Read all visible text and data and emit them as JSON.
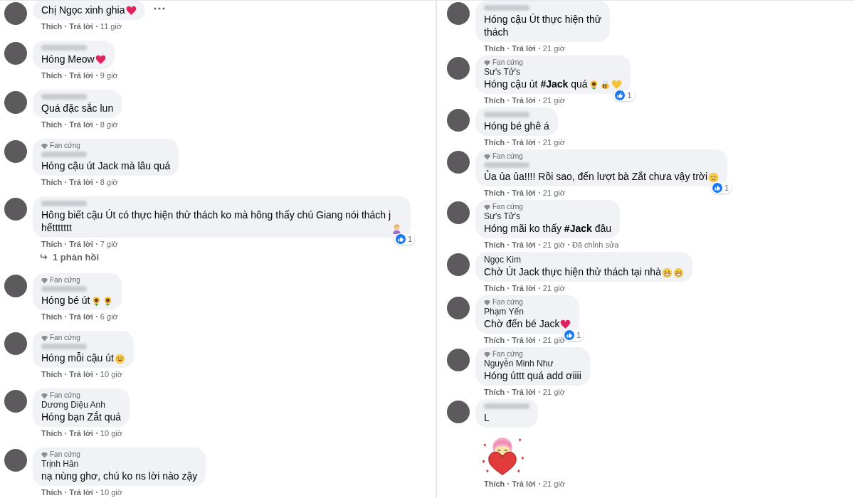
{
  "columns": [
    {
      "comments": [
        {
          "text": "Chị Ngọc xinh ghia",
          "emojis": [
            {
              "kind": "heart"
            }
          ],
          "like": "Thích",
          "reply": "Trả lời",
          "time": "11 giờ",
          "more_menu": true
        },
        {
          "name_hidden": true,
          "text": "Hóng Meow",
          "emojis": [
            {
              "kind": "heart"
            }
          ],
          "like": "Thích",
          "reply": "Trả lời",
          "time": "9 giờ"
        },
        {
          "name_hidden": true,
          "text": "Quá đặc sắc lun",
          "like": "Thích",
          "reply": "Trả lời",
          "time": "8 giờ"
        },
        {
          "badge": "Fan cứng",
          "name_hidden": true,
          "text": "Hóng cậu út Jack mà lâu quá",
          "like": "Thích",
          "reply": "Trả lời",
          "time": "8 giờ"
        },
        {
          "name_hidden": true,
          "text": "Hông biết cậu Út có thực hiện thử thách ko mà hông thấy chú Giang nói thách j\nhếttttttt",
          "emojis": [
            {
              "kind": "person"
            }
          ],
          "reaction_count": "1",
          "like": "Thích",
          "reply": "Trả lời",
          "time": "7 giờ",
          "replies": "1 phản hồi"
        },
        {
          "badge": "Fan cứng",
          "name_hidden": true,
          "text": "Hóng bé út",
          "emojis": [
            {
              "kind": "sunflower"
            },
            {
              "kind": "sunflower"
            }
          ],
          "like": "Thích",
          "reply": "Trả lời",
          "time": "6 giờ"
        },
        {
          "badge": "Fan cứng",
          "name_hidden": true,
          "text": "Hóng mỗi cậu út",
          "emojis": [
            {
              "kind": "smile"
            }
          ],
          "like": "Thích",
          "reply": "Trả lời",
          "time": "10 giờ"
        },
        {
          "badge": "Fan cứng",
          "name": "Dương Diệu Anh",
          "text": "Hóng bạn Zắt quá",
          "like": "Thích",
          "reply": "Trả lời",
          "time": "10 giờ"
        },
        {
          "badge": "Fan cứng",
          "name": "Trịnh Hân",
          "text": "nạ nùng ghơ, chú ko ns lời nào zậy",
          "like": "Thích",
          "reply": "Trả lời",
          "time": "10 giờ"
        }
      ]
    },
    {
      "comments": [
        {
          "name_hidden": true,
          "text": "Hóng cậu Út thực hiện thử\nthách",
          "like": "Thích",
          "reply": "Trả lời",
          "time": "21 giờ"
        },
        {
          "badge": "Fan cứng",
          "name": "Sư's Tử's",
          "text": "Hóng cậu út **#Jack** quá",
          "emojis": [
            {
              "kind": "sunflower"
            },
            {
              "kind": "bee"
            },
            {
              "kind": "yellow-heart"
            }
          ],
          "reaction_count": "1",
          "like": "Thích",
          "reply": "Trả lời",
          "time": "21 giờ"
        },
        {
          "name_hidden": true,
          "text": "Hóng bé ghê á",
          "like": "Thích",
          "reply": "Trả lời",
          "time": "21 giờ"
        },
        {
          "badge": "Fan cứng",
          "name_hidden": true,
          "text": "Ủa ủa ủa!!!! Rồi sao, đến lượt bà Zắt chưa vậy trời",
          "emojis": [
            {
              "kind": "worried"
            }
          ],
          "reaction_count": "1",
          "like": "Thích",
          "reply": "Trả lời",
          "time": "21 giờ"
        },
        {
          "badge": "Fan cứng",
          "name": "Sư's Tử's",
          "text": "Hóng mãi ko thấy **#Jack** đâu",
          "like": "Thích",
          "reply": "Trả lời",
          "time": "21 giờ",
          "edited": "Đã chỉnh sửa"
        },
        {
          "name": "Ngọc Kim",
          "text": "Chờ Út Jack thực hiện thử thách tại nhà",
          "emojis": [
            {
              "kind": "grin"
            },
            {
              "kind": "grin"
            }
          ],
          "like": "Thích",
          "reply": "Trả lời",
          "time": "21 giờ"
        },
        {
          "badge": "Fan cứng",
          "name": "Phạm Yến",
          "text": "Chờ đến bé Jack",
          "emojis": [
            {
              "kind": "heart"
            }
          ],
          "reaction_count": "1",
          "like": "Thích",
          "reply": "Trả lời",
          "time": "21 giờ"
        },
        {
          "badge": "Fan cứng",
          "name": "Nguyễn Minh Như",
          "text": "Hóng úttt quá add ơiiii",
          "like": "Thích",
          "reply": "Trả lời",
          "time": "21 giờ"
        },
        {
          "name_hidden": true,
          "text": "L",
          "sticker": true,
          "like": "Thích",
          "reply": "Trả lời",
          "time": "21 giờ"
        }
      ]
    }
  ]
}
